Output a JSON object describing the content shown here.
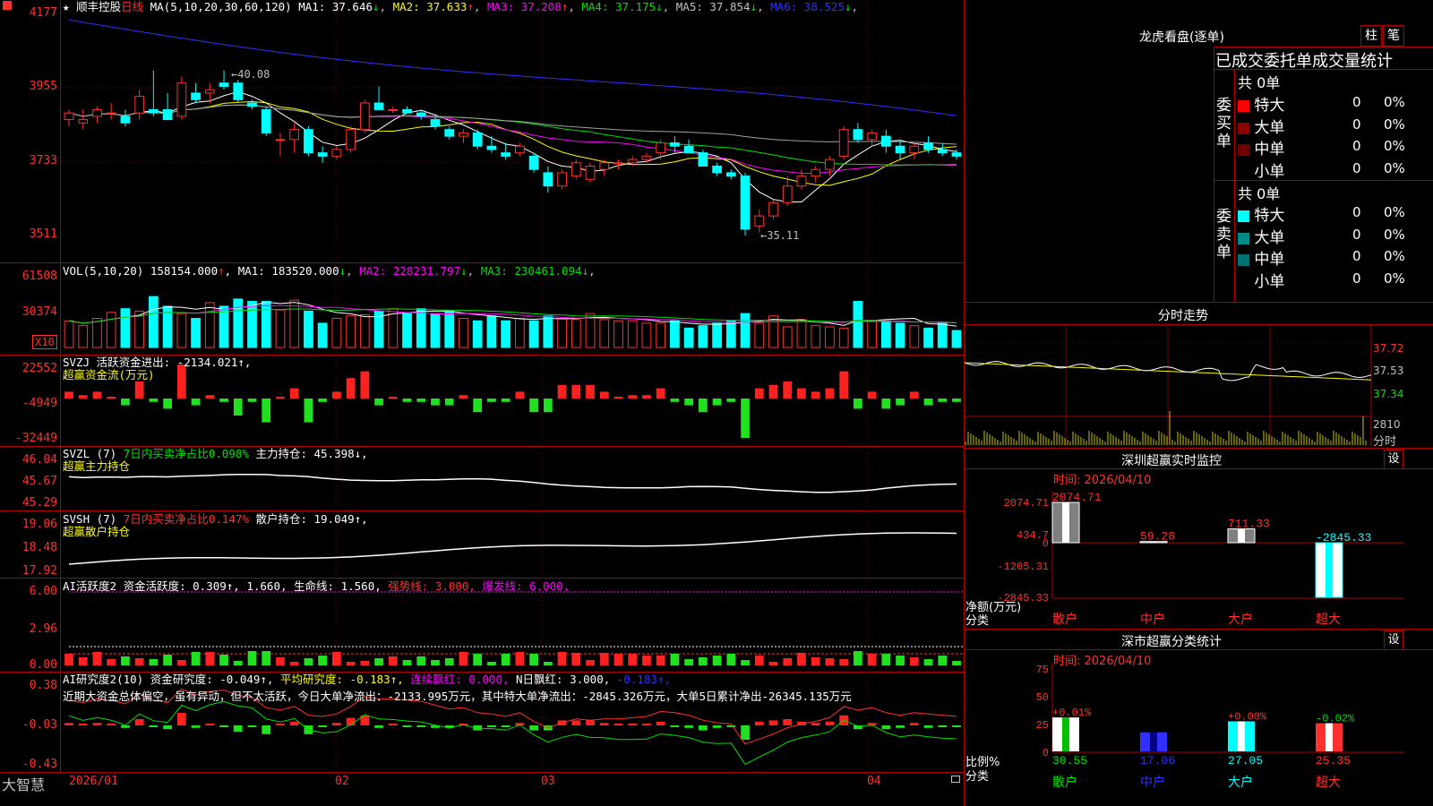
{
  "bottom_logo": "大智慧",
  "stock": {
    "star": "★",
    "name": "顺丰控股",
    "period": "日线"
  },
  "colors": {
    "up": "#ff3030",
    "down": "#00ffff",
    "grid": "#b00000",
    "white": "#ffffff",
    "yellow": "#ffff00",
    "magenta": "#ff00ff",
    "green": "#00e000",
    "blue": "#3030ff"
  },
  "main": {
    "ylabels": [
      "4177",
      "3955",
      "3733",
      "3511"
    ],
    "ma_label": "MA(5,10,20,30,60,120)",
    "ma": [
      {
        "name": "MA1:",
        "value": "37.646",
        "arrow": "↓",
        "color": "#ffffff"
      },
      {
        "name": "MA2:",
        "value": "37.633",
        "arrow": "↑",
        "color": "#ffff00"
      },
      {
        "name": "MA3:",
        "value": "37.208",
        "arrow": "↑",
        "color": "#ff00ff"
      },
      {
        "name": "MA4:",
        "value": "37.175",
        "arrow": "↓",
        "color": "#00e000"
      },
      {
        "name": "MA5:",
        "value": "37.854",
        "arrow": "↓",
        "color": "#c0c0c0"
      },
      {
        "name": "MA6:",
        "value": "38.525",
        "arrow": "↓",
        "color": "#3030ff"
      }
    ],
    "high_label": "←40.08",
    "low_label": "←35.11"
  },
  "vol": {
    "ylabels": [
      "61508",
      "30374"
    ],
    "x10": "X10",
    "title": "VOL(5,10,20)",
    "value": "158154.000",
    "arrow": "↑",
    "ma": [
      {
        "name": "MA1:",
        "value": "183520.000",
        "arrow": "↓",
        "color": "#ffffff"
      },
      {
        "name": "MA2:",
        "value": "228231.797",
        "arrow": "↓",
        "color": "#ff00ff"
      },
      {
        "name": "MA3:",
        "value": "230461.094",
        "arrow": "↓",
        "color": "#00e000"
      }
    ]
  },
  "svzj": {
    "ylabels": [
      "22552",
      "-4949",
      "-32449"
    ],
    "line1": "SVZJ  活跃资金进出: -2134.021↑,",
    "line2": "超赢资金流(万元)"
  },
  "svzl": {
    "ylabels": [
      "46.04",
      "45.67",
      "45.29"
    ],
    "a": "SVZL (7) ",
    "b": "7日内买卖净占比0.098%",
    "c": " 主力持仓: 45.398↓,",
    "line2": "超赢主力持仓"
  },
  "svsh": {
    "ylabels": [
      "19.06",
      "18.48",
      "17.92"
    ],
    "a": "SVSH (7) ",
    "b": "7日内买卖净占比0.147%",
    "c": " 散户持仓: 19.049↑,",
    "line2": "超赢散户持仓"
  },
  "ai1": {
    "ylabels": [
      "6.00",
      "2.96",
      "0.00"
    ],
    "a": "AI活跃度2 资金活跃度: 0.309↑, 1.660, 生命线: 1.560, ",
    "b": "强势线: 3.000, ",
    "c": "爆发线: 6.000,"
  },
  "ai2": {
    "ylabels": [
      "0.38",
      "-0.03",
      "-0.43"
    ],
    "a": "AI研究度2(10) 资金研究度: -0.049↑, ",
    "b": "平均研究度: -0.183↑, ",
    "c": "连续飘红: 0.000, ",
    "d": "N日飘红: 3.000, ",
    "e": "-0.183↑,",
    "line2": "近期大资金总体偏空，虽有异动，但不太活跃，今日大单净流出：-2133.995万元，其中特大单净流出：-2845.326万元，大单5日累计净出-26345.135万元"
  },
  "xaxis": [
    "2026/01",
    "02",
    "03",
    "04"
  ],
  "right": {
    "title": "龙虎看盘(逐单)",
    "btn1": "柱",
    "btn2": "笔",
    "subtitle": "已成交委托单成交量统计",
    "buy": {
      "side": "委买单",
      "count": "共 0单",
      "rows": [
        {
          "label": "特大",
          "color": "#ff0000",
          "n": "0",
          "pct": "0%"
        },
        {
          "label": "大单",
          "color": "#8b0000",
          "n": "0",
          "pct": "0%"
        },
        {
          "label": "中单",
          "color": "#700000",
          "n": "0",
          "pct": "0%"
        },
        {
          "label": "小单",
          "color": "#000000",
          "n": "0",
          "pct": "0%"
        }
      ]
    },
    "sell": {
      "side": "委卖单",
      "count": "共 0单",
      "rows": [
        {
          "label": "特大",
          "color": "#00ffff",
          "n": "0",
          "pct": "0%"
        },
        {
          "label": "大单",
          "color": "#008b8b",
          "n": "0",
          "pct": "0%"
        },
        {
          "label": "中单",
          "color": "#007070",
          "n": "0",
          "pct": "0%"
        },
        {
          "label": "小单",
          "color": "#000000",
          "n": "0",
          "pct": "0%"
        }
      ]
    },
    "fenshi": {
      "title": "分时走势",
      "prices": [
        "37.72",
        "37.53",
        "37.34"
      ],
      "vol": "2810",
      "unit": "分时"
    },
    "sz_monitor": {
      "title": "深圳超赢实时监控",
      "set": "设",
      "time": "时间: 2026/04/10",
      "ylabels": [
        "2074.71",
        "434.7",
        "0",
        "-1205.31",
        "-2845.33"
      ],
      "bars": [
        {
          "cat": "散户",
          "value": 2074.71,
          "label": "2074.71"
        },
        {
          "cat": "中户",
          "value": 59.28,
          "label": "59.28"
        },
        {
          "cat": "大户",
          "value": 711.33,
          "label": "711.33"
        },
        {
          "cat": "超大",
          "value": -2845.33,
          "label": "-2845.33"
        }
      ],
      "ylabel1": "净额(万元)",
      "ylabel2": "分类"
    },
    "sz_class": {
      "title": "深市超赢分类统计",
      "set": "设",
      "time": "时间: 2026/04/10",
      "ylabels": [
        "75",
        "50",
        "25",
        "0"
      ],
      "bars": [
        {
          "cat": "散户",
          "value": 30.55,
          "label": "30.55",
          "chg": "+0.01%"
        },
        {
          "cat": "中户",
          "value": 17.06,
          "label": "17.06",
          "chg": ""
        },
        {
          "cat": "大户",
          "value": 27.05,
          "label": "27.05",
          "chg": "+0.00%"
        },
        {
          "cat": "超大",
          "value": 25.35,
          "label": "25.35",
          "chg": "-0.02%"
        }
      ],
      "ylabel1": "比例%",
      "ylabel2": "分类"
    }
  },
  "chart_data": {
    "type": "candlestick",
    "title": "顺丰控股 日线",
    "x": [
      "2026/01",
      "02",
      "03",
      "04"
    ],
    "ohlc": [
      [
        38.6,
        38.9,
        38.4,
        38.8
      ],
      [
        38.5,
        38.9,
        38.3,
        38.6
      ],
      [
        38.7,
        39.0,
        38.5,
        38.9
      ],
      [
        38.8,
        39.1,
        38.6,
        38.8
      ],
      [
        38.7,
        38.9,
        38.4,
        38.5
      ],
      [
        38.8,
        39.5,
        38.6,
        39.3
      ],
      [
        38.9,
        40.08,
        38.7,
        38.8
      ],
      [
        38.9,
        39.4,
        38.6,
        38.6
      ],
      [
        38.7,
        39.9,
        38.6,
        39.7
      ],
      [
        39.4,
        39.7,
        39.1,
        39.2
      ],
      [
        39.4,
        39.7,
        39.1,
        39.5
      ],
      [
        39.7,
        40.08,
        39.5,
        39.6
      ],
      [
        39.7,
        39.8,
        39.1,
        39.2
      ],
      [
        39.1,
        39.2,
        38.9,
        39.0
      ],
      [
        38.9,
        39.0,
        38.1,
        38.2
      ],
      [
        38.0,
        38.2,
        37.5,
        38.0
      ],
      [
        38.0,
        38.5,
        37.6,
        38.3
      ],
      [
        38.3,
        38.4,
        37.5,
        37.6
      ],
      [
        37.6,
        37.8,
        37.3,
        37.5
      ],
      [
        37.5,
        37.8,
        37.4,
        37.7
      ],
      [
        37.7,
        38.4,
        37.6,
        38.3
      ],
      [
        38.3,
        39.2,
        38.2,
        39.1
      ],
      [
        39.1,
        39.6,
        38.9,
        38.9
      ],
      [
        38.9,
        39.0,
        38.8,
        38.9
      ],
      [
        38.9,
        39.0,
        38.8,
        38.8
      ],
      [
        38.8,
        38.9,
        38.6,
        38.7
      ],
      [
        38.6,
        38.7,
        38.3,
        38.4
      ],
      [
        38.3,
        38.4,
        38.0,
        38.1
      ],
      [
        38.1,
        38.3,
        37.9,
        38.2
      ],
      [
        38.2,
        38.3,
        37.7,
        37.8
      ],
      [
        37.8,
        38.1,
        37.6,
        37.7
      ],
      [
        37.6,
        37.9,
        37.4,
        37.5
      ],
      [
        37.6,
        37.9,
        37.5,
        37.8
      ],
      [
        37.5,
        37.6,
        37.0,
        37.1
      ],
      [
        37.0,
        37.2,
        36.4,
        36.6
      ],
      [
        36.6,
        37.1,
        36.5,
        37.0
      ],
      [
        36.9,
        37.4,
        36.8,
        37.3
      ],
      [
        36.8,
        37.3,
        36.7,
        37.2
      ],
      [
        37.1,
        37.4,
        36.9,
        37.3
      ],
      [
        37.3,
        37.4,
        37.1,
        37.3
      ],
      [
        37.3,
        37.5,
        37.2,
        37.4
      ],
      [
        37.4,
        37.6,
        37.3,
        37.5
      ],
      [
        37.6,
        38.0,
        37.4,
        37.9
      ],
      [
        37.9,
        38.1,
        37.6,
        37.8
      ],
      [
        37.8,
        38.0,
        37.6,
        37.6
      ],
      [
        37.6,
        37.7,
        37.2,
        37.2
      ],
      [
        37.2,
        37.3,
        36.9,
        37.0
      ],
      [
        37.0,
        37.1,
        36.8,
        36.9
      ],
      [
        36.9,
        37.0,
        35.11,
        35.3
      ],
      [
        35.4,
        35.9,
        35.2,
        35.7
      ],
      [
        35.7,
        36.2,
        35.6,
        36.1
      ],
      [
        36.1,
        36.9,
        36.0,
        36.6
      ],
      [
        36.6,
        37.1,
        36.5,
        36.9
      ],
      [
        36.9,
        37.2,
        36.7,
        37.1
      ],
      [
        37.1,
        37.5,
        36.9,
        37.4
      ],
      [
        37.5,
        38.4,
        37.4,
        38.3
      ],
      [
        38.3,
        38.5,
        37.9,
        38.0
      ],
      [
        38.0,
        38.3,
        37.8,
        38.2
      ],
      [
        38.1,
        38.3,
        37.6,
        37.8
      ],
      [
        37.8,
        38.0,
        37.4,
        37.6
      ],
      [
        37.6,
        37.9,
        37.4,
        37.8
      ],
      [
        37.9,
        38.1,
        37.6,
        37.7
      ],
      [
        37.7,
        37.9,
        37.5,
        37.6
      ],
      [
        37.6,
        37.7,
        37.4,
        37.5
      ]
    ],
    "volume": [
      22,
      18,
      24,
      29,
      32,
      30,
      42,
      34,
      28,
      24,
      37,
      34,
      40,
      38,
      38,
      31,
      39,
      30,
      20,
      24,
      26,
      27,
      30,
      32,
      28,
      32,
      28,
      30,
      24,
      22,
      26,
      22,
      24,
      22,
      26,
      24,
      23,
      28,
      23,
      22,
      22,
      20,
      20,
      22,
      16,
      18,
      20,
      22,
      28,
      20,
      26,
      17,
      23,
      18,
      17,
      16,
      38,
      22,
      22,
      20,
      18,
      16,
      20,
      14
    ],
    "ylim": [
      35.11,
      41.77
    ],
    "vol_ylim": [
      0,
      61508
    ]
  }
}
